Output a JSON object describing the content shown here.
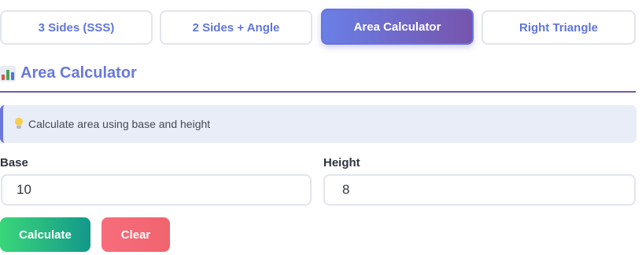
{
  "tabs": [
    {
      "label": "3 Sides (SSS)",
      "active": false
    },
    {
      "label": "2 Sides + Angle",
      "active": false
    },
    {
      "label": "Area Calculator",
      "active": true
    },
    {
      "label": "Right Triangle",
      "active": false
    }
  ],
  "section": {
    "icon": "bar-chart-icon",
    "title": "Area Calculator"
  },
  "info": {
    "icon": "lightbulb-icon",
    "text": "Calculate area using base and height"
  },
  "fields": {
    "base": {
      "label": "Base",
      "value": "10"
    },
    "height": {
      "label": "Height",
      "value": "8"
    }
  },
  "buttons": {
    "calculate": "Calculate",
    "clear": "Clear"
  },
  "colors": {
    "accent": "#6a78dc",
    "active_tab_gradient": [
      "#6a7fe6",
      "#7654ad"
    ],
    "calculate_gradient": [
      "#3ad67a",
      "#13988a"
    ],
    "clear": "#f26a76"
  }
}
